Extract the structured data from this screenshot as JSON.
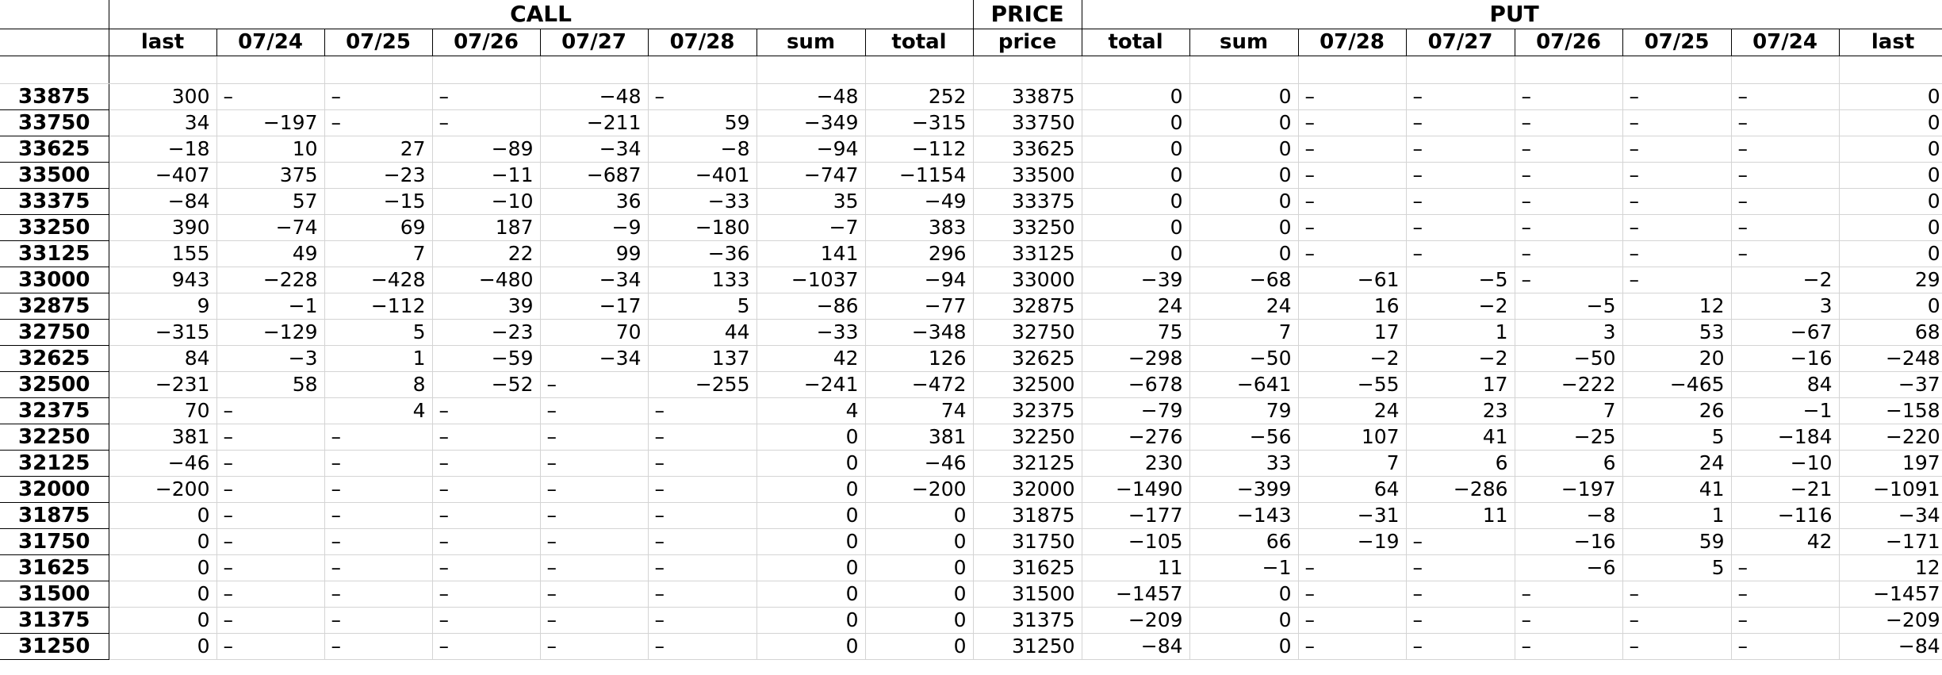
{
  "header": {
    "groups": [
      "CALL",
      "PRICE",
      "PUT"
    ],
    "columns": [
      "last",
      "07/24",
      "07/25",
      "07/26",
      "07/27",
      "07/28",
      "sum",
      "total",
      "price",
      "total",
      "sum",
      "07/28",
      "07/27",
      "07/26",
      "07/25",
      "07/24",
      "last"
    ]
  },
  "rows": [
    {
      "label": "33875",
      "cells": [
        "300",
        "–",
        "–",
        "–",
        "-48",
        "–",
        "-48",
        "252",
        "33875",
        "0",
        "0",
        "–",
        "–",
        "–",
        "–",
        "–",
        "0"
      ]
    },
    {
      "label": "33750",
      "cells": [
        "34",
        "-197",
        "–",
        "–",
        "-211",
        "59",
        "-349",
        "-315",
        "33750",
        "0",
        "0",
        "–",
        "–",
        "–",
        "–",
        "–",
        "0"
      ]
    },
    {
      "label": "33625",
      "cells": [
        "-18",
        "10",
        "27",
        "-89",
        "-34",
        "-8",
        "-94",
        "-112",
        "33625",
        "0",
        "0",
        "–",
        "–",
        "–",
        "–",
        "–",
        "0"
      ]
    },
    {
      "label": "33500",
      "cells": [
        "-407",
        "375",
        "-23",
        "-11",
        "-687",
        "-401",
        "-747",
        "-1154",
        "33500",
        "0",
        "0",
        "–",
        "–",
        "–",
        "–",
        "–",
        "0"
      ]
    },
    {
      "label": "33375",
      "cells": [
        "-84",
        "57",
        "-15",
        "-10",
        "36",
        "-33",
        "35",
        "-49",
        "33375",
        "0",
        "0",
        "–",
        "–",
        "–",
        "–",
        "–",
        "0"
      ]
    },
    {
      "label": "33250",
      "cells": [
        "390",
        "-74",
        "69",
        "187",
        "-9",
        "-180",
        "-7",
        "383",
        "33250",
        "0",
        "0",
        "–",
        "–",
        "–",
        "–",
        "–",
        "0"
      ]
    },
    {
      "label": "33125",
      "cells": [
        "155",
        "49",
        "7",
        "22",
        "99",
        "-36",
        "141",
        "296",
        "33125",
        "0",
        "0",
        "–",
        "–",
        "–",
        "–",
        "–",
        "0"
      ]
    },
    {
      "label": "33000",
      "cells": [
        "943",
        "-228",
        "-428",
        "-480",
        "-34",
        "133",
        "-1037",
        "-94",
        "33000",
        "-39",
        "-68",
        "-61",
        "-5",
        "–",
        "–",
        "-2",
        "29"
      ]
    },
    {
      "label": "32875",
      "cells": [
        "9",
        "-1",
        "-112",
        "39",
        "-17",
        "5",
        "-86",
        "-77",
        "32875",
        "24",
        "24",
        "16",
        "-2",
        "-5",
        "12",
        "3",
        "0"
      ]
    },
    {
      "label": "32750",
      "cells": [
        "-315",
        "-129",
        "5",
        "-23",
        "70",
        "44",
        "-33",
        "-348",
        "32750",
        "75",
        "7",
        "17",
        "1",
        "3",
        "53",
        "-67",
        "68"
      ]
    },
    {
      "label": "32625",
      "cells": [
        "84",
        "-3",
        "1",
        "-59",
        "-34",
        "137",
        "42",
        "126",
        "32625",
        "-298",
        "-50",
        "-2",
        "-2",
        "-50",
        "20",
        "-16",
        "-248"
      ]
    },
    {
      "label": "32500",
      "cells": [
        "-231",
        "58",
        "8",
        "-52",
        "–",
        "-255",
        "-241",
        "-472",
        "32500",
        "-678",
        "-641",
        "-55",
        "17",
        "-222",
        "-465",
        "84",
        "-37"
      ]
    },
    {
      "label": "32375",
      "cells": [
        "70",
        "–",
        "4",
        "–",
        "–",
        "–",
        "4",
        "74",
        "32375",
        "-79",
        "79",
        "24",
        "23",
        "7",
        "26",
        "-1",
        "-158"
      ]
    },
    {
      "label": "32250",
      "cells": [
        "381",
        "–",
        "–",
        "–",
        "–",
        "–",
        "0",
        "381",
        "32250",
        "-276",
        "-56",
        "107",
        "41",
        "-25",
        "5",
        "-184",
        "-220"
      ]
    },
    {
      "label": "32125",
      "cells": [
        "-46",
        "–",
        "–",
        "–",
        "–",
        "–",
        "0",
        "-46",
        "32125",
        "230",
        "33",
        "7",
        "6",
        "6",
        "24",
        "-10",
        "197"
      ]
    },
    {
      "label": "32000",
      "cells": [
        "-200",
        "–",
        "–",
        "–",
        "–",
        "–",
        "0",
        "-200",
        "32000",
        "-1490",
        "-399",
        "64",
        "-286",
        "-197",
        "41",
        "-21",
        "-1091"
      ]
    },
    {
      "label": "31875",
      "cells": [
        "0",
        "–",
        "–",
        "–",
        "–",
        "–",
        "0",
        "0",
        "31875",
        "-177",
        "-143",
        "-31",
        "11",
        "-8",
        "1",
        "-116",
        "-34"
      ]
    },
    {
      "label": "31750",
      "cells": [
        "0",
        "–",
        "–",
        "–",
        "–",
        "–",
        "0",
        "0",
        "31750",
        "-105",
        "66",
        "-19",
        "–",
        "-16",
        "59",
        "42",
        "-171"
      ]
    },
    {
      "label": "31625",
      "cells": [
        "0",
        "–",
        "–",
        "–",
        "–",
        "–",
        "0",
        "0",
        "31625",
        "11",
        "-1",
        "–",
        "–",
        "-6",
        "5",
        "–",
        "12"
      ]
    },
    {
      "label": "31500",
      "cells": [
        "0",
        "–",
        "–",
        "–",
        "–",
        "–",
        "0",
        "0",
        "31500",
        "-1457",
        "0",
        "–",
        "–",
        "–",
        "–",
        "–",
        "-1457"
      ]
    },
    {
      "label": "31375",
      "cells": [
        "0",
        "–",
        "–",
        "–",
        "–",
        "–",
        "0",
        "0",
        "31375",
        "-209",
        "0",
        "–",
        "–",
        "–",
        "–",
        "–",
        "-209"
      ]
    },
    {
      "label": "31250",
      "cells": [
        "0",
        "–",
        "–",
        "–",
        "–",
        "–",
        "0",
        "0",
        "31250",
        "-84",
        "0",
        "–",
        "–",
        "–",
        "–",
        "–",
        "-84"
      ]
    }
  ]
}
